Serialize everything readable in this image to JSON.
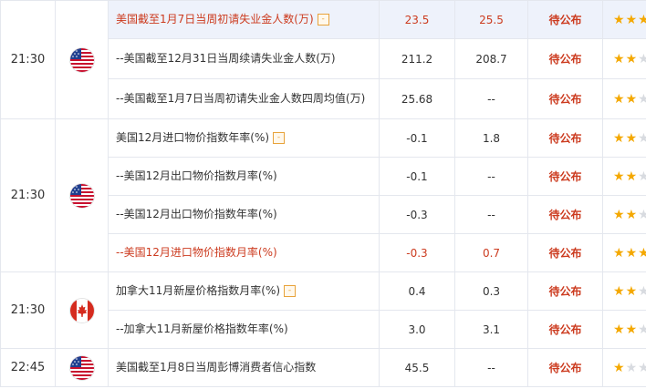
{
  "groups": [
    {
      "time": "21:30",
      "flag": "us-flag-icon",
      "rows": [
        {
          "indicator": "美国截至1月7日当周初请失业金人数(万)",
          "badge": "-",
          "previous": "23.5",
          "forecast": "25.5",
          "status": "待公布",
          "stars": 3,
          "highlight": true,
          "red": true
        },
        {
          "indicator": "--美国截至12月31日当周续请失业金人数(万)",
          "previous": "211.2",
          "forecast": "208.7",
          "status": "待公布",
          "stars": 2
        },
        {
          "indicator": "--美国截至1月7日当周初请失业金人数四周均值(万)",
          "previous": "25.68",
          "forecast": "--",
          "status": "待公布",
          "stars": 2
        }
      ]
    },
    {
      "time": "21:30",
      "flag": "us-flag-icon",
      "rows": [
        {
          "indicator": "美国12月进口物价指数年率(%)",
          "badge": "-",
          "previous": "-0.1",
          "forecast": "1.8",
          "status": "待公布",
          "stars": 2
        },
        {
          "indicator": "--美国12月出口物价指数月率(%)",
          "previous": "-0.1",
          "forecast": "--",
          "status": "待公布",
          "stars": 2
        },
        {
          "indicator": "--美国12月出口物价指数年率(%)",
          "previous": "-0.3",
          "forecast": "--",
          "status": "待公布",
          "stars": 2
        },
        {
          "indicator": "--美国12月进口物价指数月率(%)",
          "previous": "-0.3",
          "forecast": "0.7",
          "status": "待公布",
          "stars": 3,
          "red": true
        }
      ]
    },
    {
      "time": "21:30",
      "flag": "canada-flag-icon",
      "rows": [
        {
          "indicator": "加拿大11月新屋价格指数月率(%)",
          "badge": "-",
          "previous": "0.4",
          "forecast": "0.3",
          "status": "待公布",
          "stars": 2
        },
        {
          "indicator": "--加拿大11月新屋价格指数年率(%)",
          "previous": "3.0",
          "forecast": "3.1",
          "status": "待公布",
          "stars": 2
        }
      ]
    },
    {
      "time": "22:45",
      "flag": "us-flag-icon",
      "rows": [
        {
          "indicator": "美国截至1月8日当周彭博消费者信心指数",
          "previous": "45.5",
          "forecast": "--",
          "status": "待公布",
          "stars": 1
        }
      ]
    }
  ],
  "colors": {
    "accent_red": "#cc3b1f",
    "star_on": "#f4a800",
    "highlight_bg": "#eef2fb"
  }
}
